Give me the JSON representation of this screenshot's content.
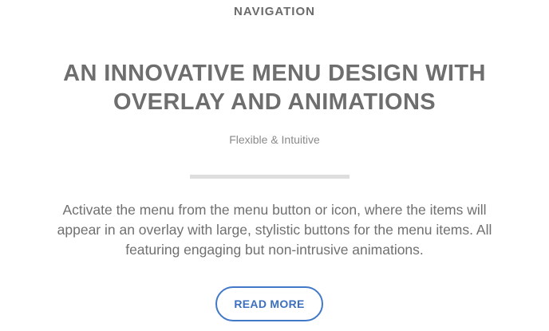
{
  "section": {
    "eyebrow": "NAVIGATION",
    "title": "AN INNOVATIVE MENU DESIGN WITH OVERLAY AND ANIMATIONS",
    "subtitle": "Flexible & Intuitive",
    "description": "Activate the menu from the menu button or icon, where the items will appear in an overlay with large, stylistic buttons for the menu items. All featuring engaging but non-intrusive animations.",
    "cta_label": "READ MORE"
  },
  "colors": {
    "heading": "#6e6e6e",
    "body_text": "#707070",
    "accent": "#4178c7",
    "divider": "#dedede"
  }
}
